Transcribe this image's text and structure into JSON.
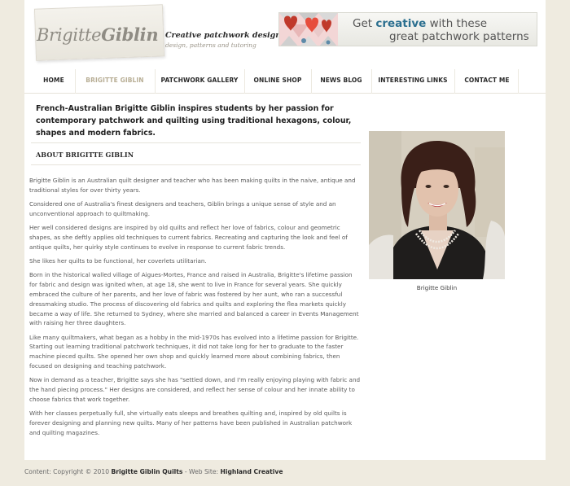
{
  "header": {
    "logo_first": "Brigitte",
    "logo_last": "Giblin",
    "tagline": "Creative patchwork design",
    "tagline_sub": "design, patterns and tutoring",
    "banner_line1_pre": "Get ",
    "banner_line1_highlight": "creative",
    "banner_line1_post": " with these",
    "banner_line2": "great patchwork patterns"
  },
  "nav": {
    "items": [
      {
        "label": "HOME"
      },
      {
        "label": "BRIGITTE GIBLIN"
      },
      {
        "label": "PATCHWORK GALLERY"
      },
      {
        "label": "ONLINE SHOP"
      },
      {
        "label": "NEWS BLOG"
      },
      {
        "label": "INTERESTING LINKS"
      },
      {
        "label": "CONTACT ME"
      }
    ],
    "active": "BRIGITTE GIBLIN"
  },
  "main": {
    "intro": "French-Australian Brigitte Giblin inspires students by her passion for contemporary patchwork and quilting using traditional hexagons, colour, shapes and modern fabrics.",
    "section_title": "ABOUT BRIGITTE GIBLIN",
    "paragraphs": [
      "Brigitte Giblin is an Australian quilt designer and teacher who has been making quilts in the naive, antique and traditional styles for over thirty years.",
      "Considered one of Australia's finest designers and teachers, Giblin brings a unique sense of style and an unconventional approach to quiltmaking.",
      "Her well considered designs are inspired by old quilts and reflect her love of fabrics, colour and geometric shapes, as she deftly applies old techniques to  current fabrics. Recreating and capturing the look and feel of antique quilts, her quirky style continues to evolve in response to current fabric trends.",
      "She likes her quilts to be functional, her coverlets utilitarian.",
      "Born in the historical walled village of Aigues-Mortes, France and raised in Australia, Brigitte's lifetime passion for fabric and design was ignited when, at age 18, she went to live in France for several years. She quickly embraced the culture of her parents, and her love of fabric was fostered by her aunt, who ran a successful dressmaking studio. The process of discovering old fabrics and quilts and exploring the flea markets quickly became a way of life. She returned to Sydney, where she married and balanced a career in Events Management with raising her three daughters.",
      "Like many quiltmakers, what began as a hobby in the mid-1970s has evolved into a lifetime passion for Brigitte. Starting out learning traditional patchwork techniques, it did not take long for her to graduate to the faster machine pieced quilts. She opened her own shop and quickly learned more about combining fabrics, then focused on designing and teaching patchwork.",
      "Now in demand as a teacher, Brigitte says she has \"settled down, and I'm really enjoying playing with fabric and the hand piecing process.\" Her designs are considered, and reflect her sense of colour and her innate ability to choose fabrics that work together.",
      "With her classes perpetually full, she virtually eats sleeps and breathes quilting and, inspired by old quilts is forever designing and planning new quilts. Many of her patterns have been published in Australian patchwork and quilting magazines."
    ],
    "photo_caption": "Brigitte Giblin"
  },
  "footer": {
    "prefix": "Content: Copyright © 2010 ",
    "owner": "Brigitte Giblin Quilts",
    "mid": " - Web Site: ",
    "site": "Highland Creative"
  },
  "colors": {
    "page_bg": "#efebe0",
    "nav_active": "#b8ae95",
    "banner_highlight": "#2b6f8f"
  }
}
